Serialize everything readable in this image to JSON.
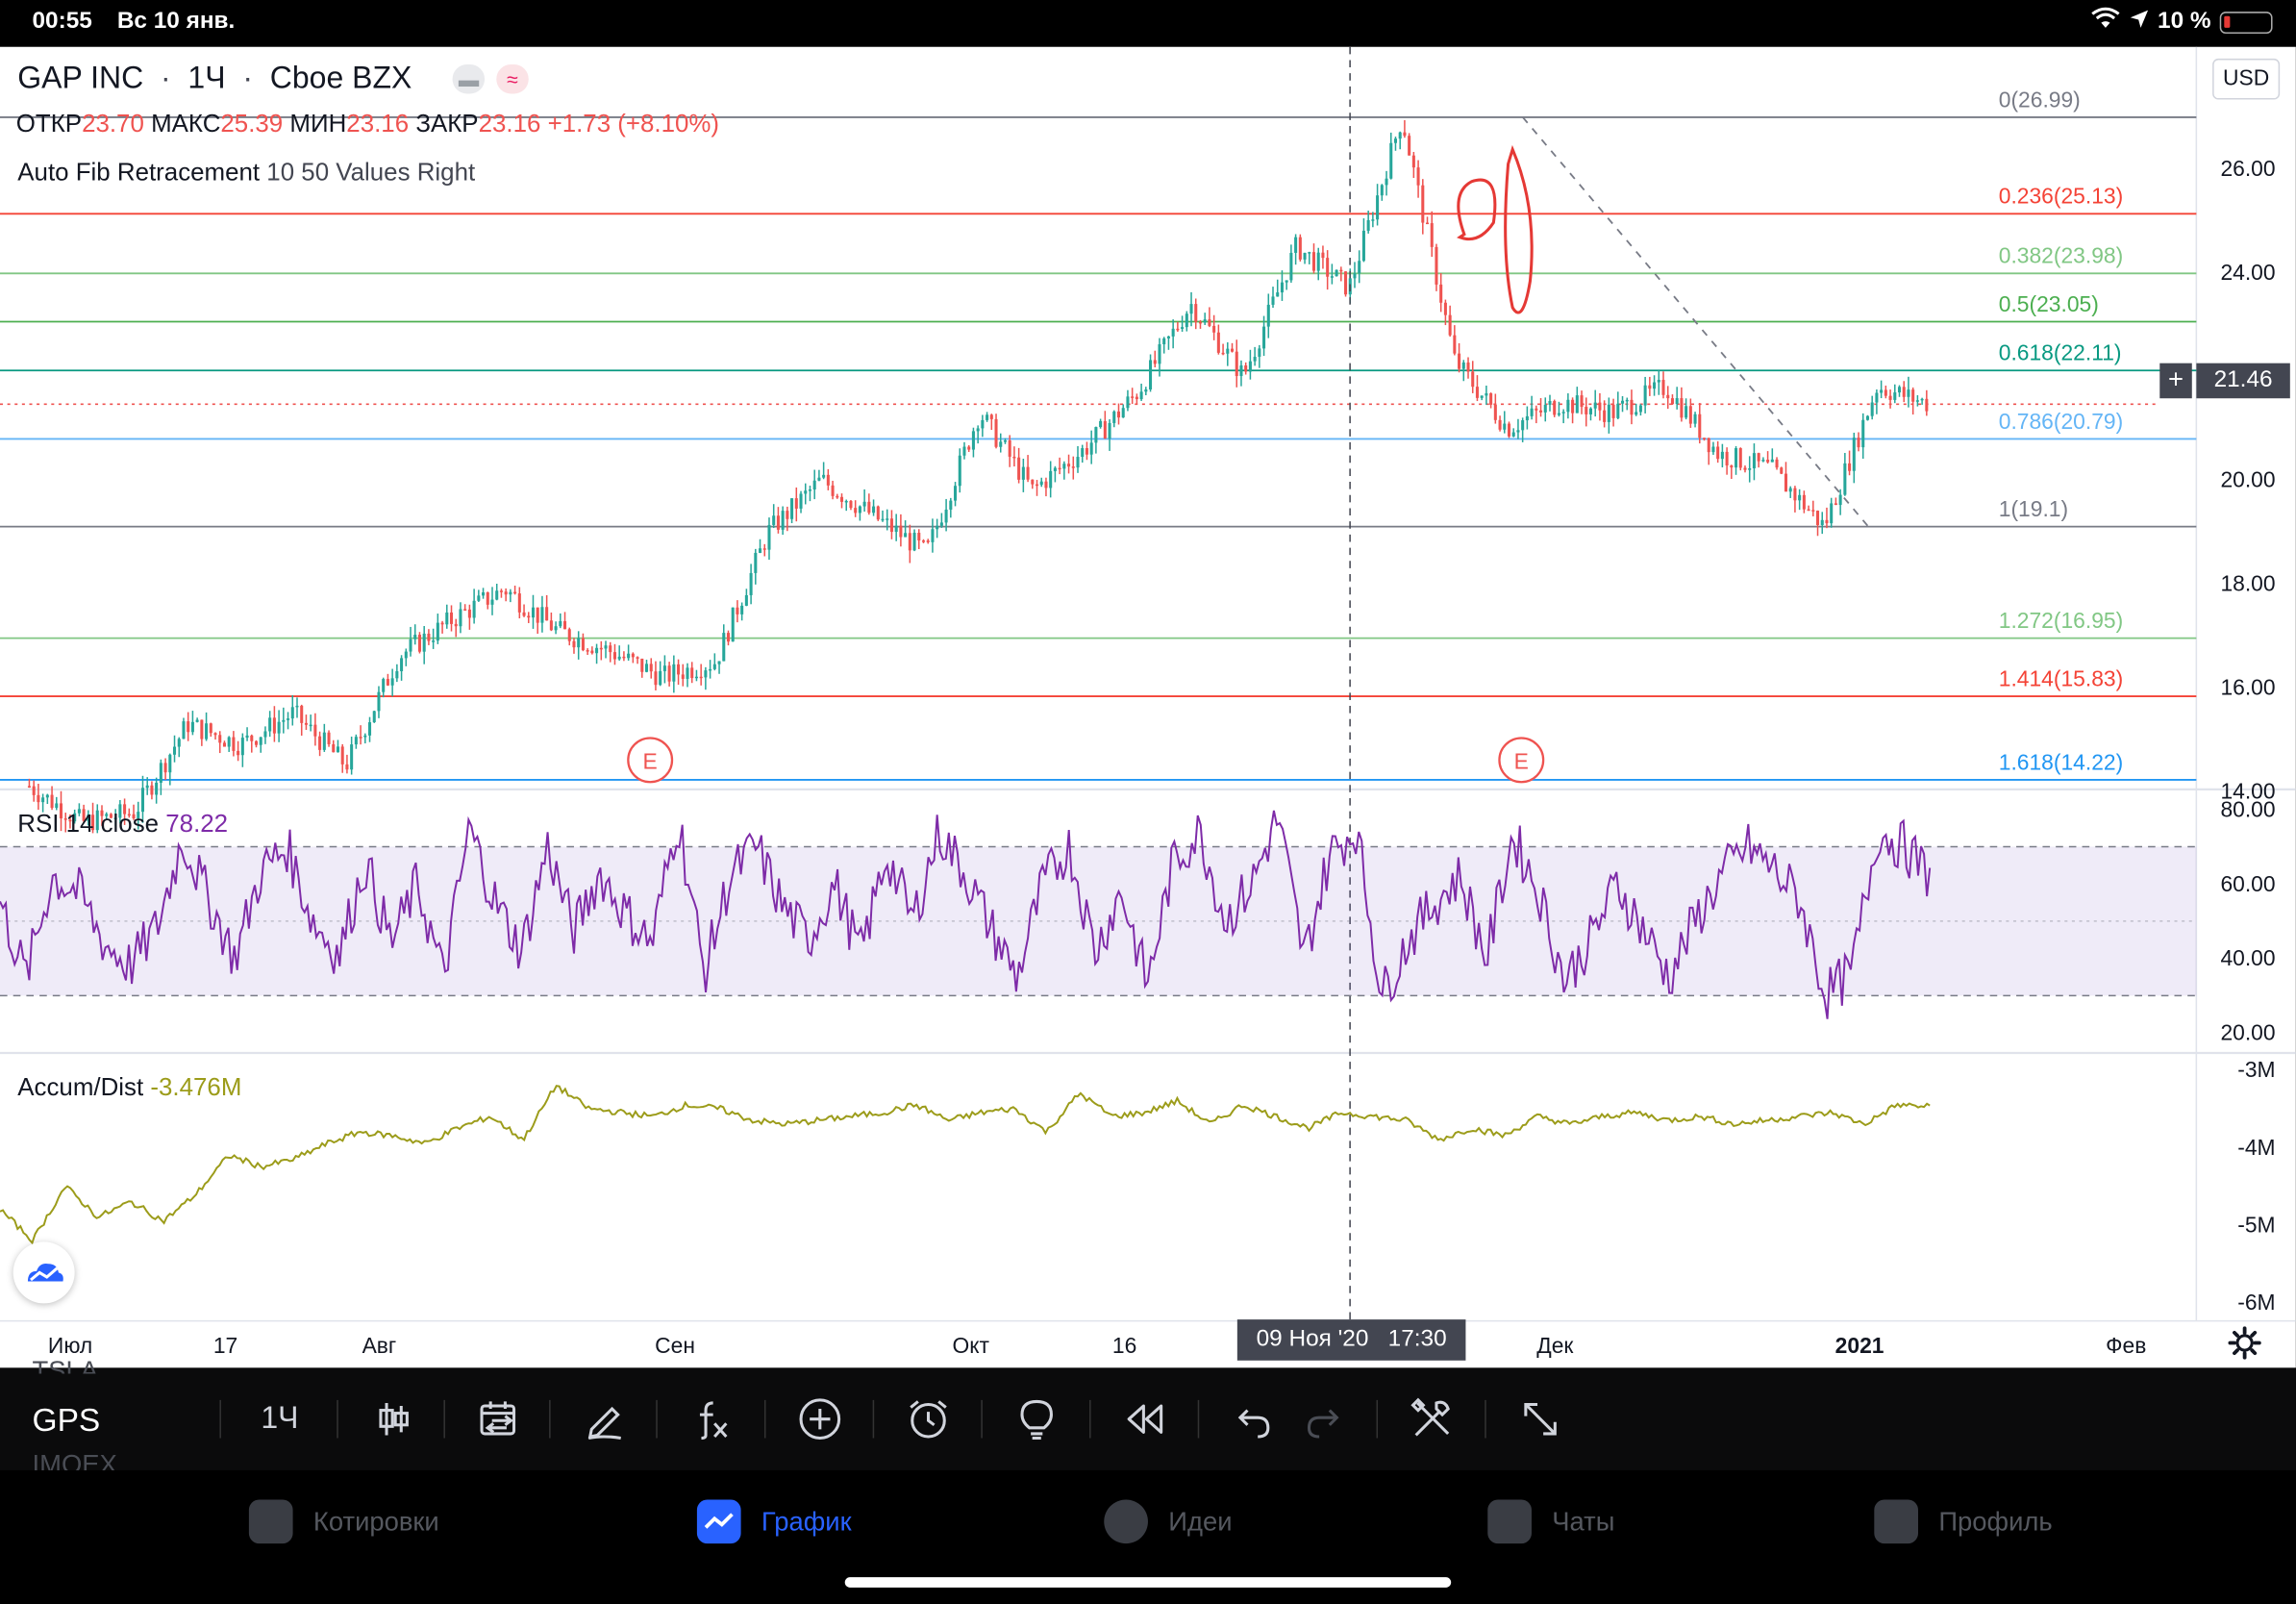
{
  "status_bar": {
    "time": "00:55",
    "date": "Вс 10 янв.",
    "battery": "10 %"
  },
  "symbol": {
    "name": "GAP INC",
    "interval": "1Ч",
    "exchange": "Cboe BZX",
    "currency": "USD"
  },
  "ohlc": {
    "open_label": "ОТКР",
    "open": "23.70",
    "high_label": "МАКС",
    "high": "25.39",
    "low_label": "МИН",
    "low": "23.16",
    "close_label": "ЗАКР",
    "close": "23.16",
    "change": "+1.73 (+8.10%)"
  },
  "indicator_title": "Auto Fib Retracement",
  "indicator_params": "10 50 Values Right",
  "fib_levels": [
    {
      "label": "0(26.99)",
      "price": 26.99,
      "color": "#787b86"
    },
    {
      "label": "0.236(25.13)",
      "price": 25.13,
      "color": "#f44336"
    },
    {
      "label": "0.382(23.98)",
      "price": 23.98,
      "color": "#81c784"
    },
    {
      "label": "0.5(23.05)",
      "price": 23.05,
      "color": "#4caf50"
    },
    {
      "label": "0.618(22.11)",
      "price": 22.11,
      "color": "#089981"
    },
    {
      "label": "0.786(20.79)",
      "price": 20.79,
      "color": "#64b5f6"
    },
    {
      "label": "1(19.1)",
      "price": 19.1,
      "color": "#787b86"
    },
    {
      "label": "1.272(16.95)",
      "price": 16.95,
      "color": "#81c784"
    },
    {
      "label": "1.414(15.83)",
      "price": 15.83,
      "color": "#f44336"
    },
    {
      "label": "1.618(14.22)",
      "price": 14.22,
      "color": "#2196f3"
    }
  ],
  "price_axis": [
    "26.00",
    "24.00",
    "22.00",
    "20.00",
    "18.00",
    "16.00",
    "14.00"
  ],
  "current_price": "21.46",
  "earnings_marker": "E",
  "rsi": {
    "label": "RSI 14 close",
    "value": "78.22",
    "axis": [
      "80.00",
      "60.00",
      "40.00",
      "20.00"
    ]
  },
  "accum": {
    "label": "Accum/Dist",
    "value": "-3.476M",
    "axis": [
      "-3M",
      "-4M",
      "-5M",
      "-6M"
    ]
  },
  "time_axis": [
    "Июл",
    "17",
    "Авг",
    "Сен",
    "Окт",
    "16",
    "Дек",
    "2021",
    "Фев"
  ],
  "crosshair_label": "09 Ноя '20   17:30",
  "toolbar": {
    "symbol": "GPS",
    "symbol_above": "TSLA",
    "symbol_below": "IMOEX",
    "interval": "1Ч"
  },
  "tabs": [
    "Котировки",
    "График",
    "Идеи",
    "Чаты",
    "Профиль"
  ],
  "colors": {
    "up": "#26a69a",
    "down": "#ef5350",
    "rsi_line": "#7e2ba8",
    "accum_line": "#9c9c1a",
    "tab_active": "#2962ff"
  },
  "chart_data": [
    {
      "type": "candlestick",
      "title": "GAP INC · 1Ч · Cboe BZX",
      "x_ticks": [
        "Июл",
        "17",
        "Авг",
        "Сен",
        "Окт",
        "16",
        "Дек",
        "2021",
        "Фев"
      ],
      "ylim": [
        13.5,
        27.5
      ],
      "y_ticks": [
        26,
        24,
        22,
        20,
        18,
        16,
        14
      ],
      "close_path": [
        [
          "Июл",
          14.1
        ],
        [
          "17",
          13.4
        ],
        [
          "Авг",
          13.6
        ],
        [
          "Авг",
          15.3
        ],
        [
          "Авг",
          14.9
        ],
        [
          "Авг",
          15.5
        ],
        [
          "Авг",
          14.5
        ],
        [
          "Авг",
          16.6
        ],
        [
          "Сен",
          17.3
        ],
        [
          "Сен",
          17.9
        ],
        [
          "Сен",
          17.1
        ],
        [
          "Сен",
          16.7
        ],
        [
          "Сен",
          16.2
        ],
        [
          "Окт",
          16.5
        ],
        [
          "Окт",
          19.0
        ],
        [
          "Окт",
          20.0
        ],
        [
          "16",
          19.3
        ],
        [
          "16",
          18.6
        ],
        [
          "16",
          21.3
        ],
        [
          "16",
          19.8
        ],
        [
          "16",
          20.6
        ],
        [
          "16",
          21.7
        ],
        [
          "Дек",
          23.4
        ],
        [
          "Дек",
          22.0
        ],
        [
          "Дек",
          24.5
        ],
        [
          "Дек",
          23.7
        ],
        [
          "Дек",
          26.99
        ],
        [
          "Дек",
          22.3
        ],
        [
          "Дек",
          21.0
        ],
        [
          "Дек",
          21.5
        ],
        [
          "Дек",
          21.3
        ],
        [
          "Дек",
          21.8
        ],
        [
          "Дек",
          20.5
        ],
        [
          "Дек",
          20.2
        ],
        [
          "2021",
          19.1
        ],
        [
          "2021",
          21.8
        ],
        [
          "2021",
          21.46
        ]
      ]
    },
    {
      "type": "line",
      "title": "RSI 14 close",
      "ylim": [
        15,
        85
      ],
      "bands": [
        30,
        70
      ],
      "values": [
        55,
        35,
        62,
        58,
        44,
        38,
        48,
        72,
        56,
        40,
        63,
        70,
        50,
        41,
        66,
        44,
        60,
        35,
        75,
        55,
        42,
        70,
        47,
        63,
        52,
        44,
        78,
        36,
        62,
        70,
        54,
        45,
        60,
        41,
        68,
        50,
        74,
        63,
        48,
        35,
        60,
        70,
        42,
        58,
        33,
        66,
        74,
        50,
        60,
        78,
        40,
        68,
        75,
        30,
        45,
        55,
        62,
        40,
        73,
        58,
        34,
        45,
        60,
        48,
        35,
        50,
        62,
        70,
        64,
        56,
        30,
        36,
        74,
        70,
        62
      ],
      "value_label": "78.22"
    },
    {
      "type": "line",
      "title": "Accum/Dist",
      "ylim": [
        -6.2,
        -2.8
      ],
      "values": [
        -4.8,
        -5.2,
        -4.5,
        -4.9,
        -4.7,
        -4.95,
        -4.6,
        -4.1,
        -4.25,
        -4.15,
        -3.95,
        -3.8,
        -3.85,
        -3.95,
        -3.75,
        -3.6,
        -3.9,
        -3.2,
        -3.5,
        -3.55,
        -3.6,
        -3.45,
        -3.5,
        -3.65,
        -3.7,
        -3.65,
        -3.6,
        -3.55,
        -3.45,
        -3.65,
        -3.55,
        -3.5,
        -3.8,
        -3.3,
        -3.6,
        -3.55,
        -3.4,
        -3.7,
        -3.45,
        -3.6,
        -3.75,
        -3.55,
        -3.6,
        -3.65,
        -3.9,
        -3.75,
        -3.85,
        -3.6,
        -3.7,
        -3.6,
        -3.55,
        -3.65,
        -3.6,
        -3.7,
        -3.65,
        -3.6,
        -3.55,
        -3.7,
        -3.45,
        -3.476
      ],
      "value_label": "-3.476M"
    }
  ]
}
